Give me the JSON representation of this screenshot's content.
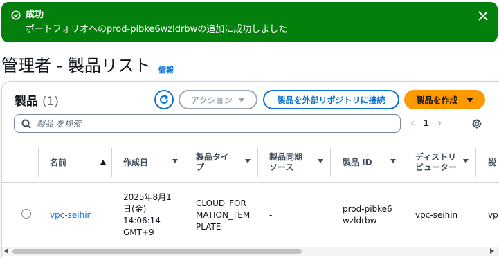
{
  "flash": {
    "title": "成功",
    "message": "ポートフォリオへのprod-pibke6wzldrbwの追加に成功しました",
    "status_icon": "check-circle-icon",
    "close_icon": "close-icon",
    "color": "#037f0c"
  },
  "page": {
    "title": "管理者 - 製品リスト",
    "info_link": "情報"
  },
  "table": {
    "title": "製品",
    "count": "(1)",
    "actions_label": "アクション",
    "connect_label": "製品を外部リポジトリに接続",
    "create_label": "製品を作成",
    "search_placeholder": "製品 を検索",
    "current_page": "1",
    "columns": [
      "名前",
      "作成日",
      "製品タイプ",
      "製品同期ソース",
      "製品 ID",
      "ディストリビューター",
      "説"
    ],
    "rows": [
      {
        "name": "vpc-seihin",
        "created": "2025年8月1日(金) 14:06:14 GMT+9",
        "type": "CLOUD_FORMATION_TEMPLATE",
        "sync_source": "-",
        "product_id": "prod-pibke6wzldrbw",
        "distributor": "vpc-seihin",
        "description": "vp"
      }
    ]
  },
  "colors": {
    "primary": "#0972d3",
    "success": "#037f0c",
    "create_button": "#ff9900"
  }
}
